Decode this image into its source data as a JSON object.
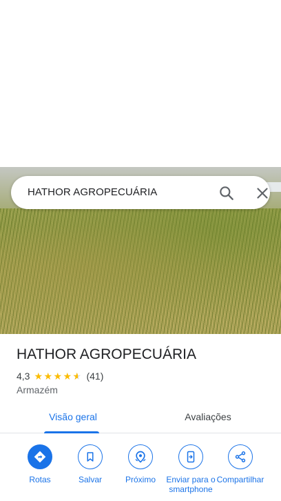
{
  "search": {
    "query": "HATHOR AGROPECUÁRIA"
  },
  "place": {
    "name": "HATHOR AGROPECUÁRIA",
    "rating": "4,3",
    "stars": 4.3,
    "review_count": "(41)",
    "category": "Armazém"
  },
  "tabs": [
    {
      "label": "Visão geral",
      "active": true
    },
    {
      "label": "Avaliações",
      "active": false
    }
  ],
  "actions": [
    {
      "label": "Rotas",
      "icon": "directions-icon"
    },
    {
      "label": "Salvar",
      "icon": "bookmark-icon"
    },
    {
      "label": "Próximo",
      "icon": "nearby-icon"
    },
    {
      "label": "Enviar para o smartphone",
      "icon": "send-to-phone-icon"
    },
    {
      "label": "Compartilhar",
      "icon": "share-icon"
    }
  ],
  "colors": {
    "accent": "#1a73e8",
    "star": "#fbbc04"
  }
}
